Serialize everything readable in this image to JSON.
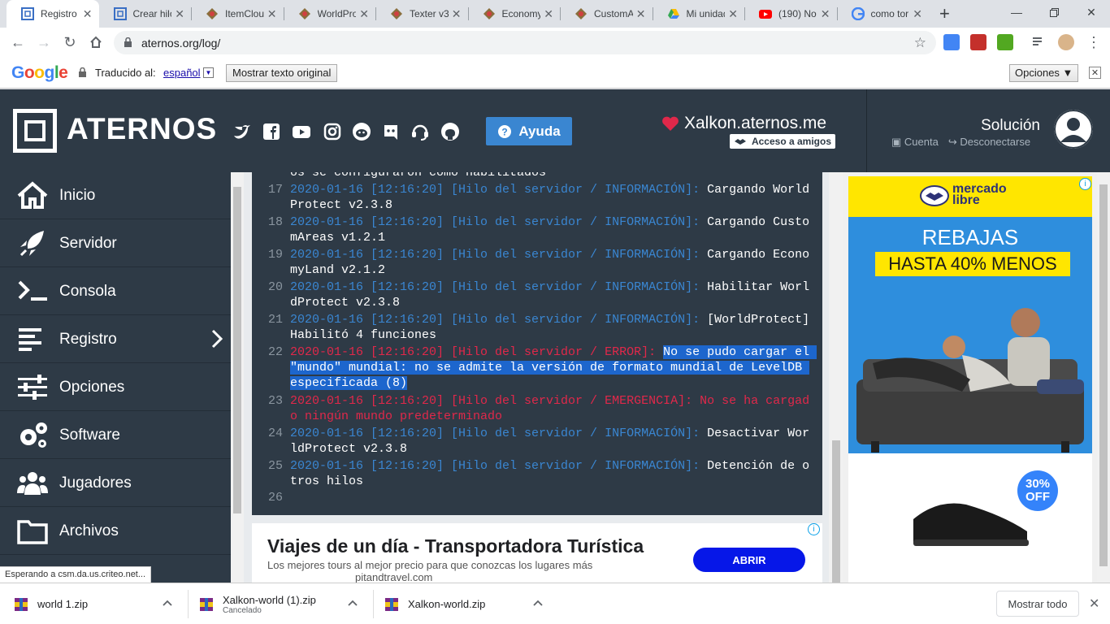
{
  "browser": {
    "tabs": [
      {
        "title": "Registro | A",
        "icon": "aternos-icon",
        "active": true
      },
      {
        "title": "Crear hilo",
        "icon": "aternos-icon"
      },
      {
        "title": "ItemCloud",
        "icon": "poggit-icon"
      },
      {
        "title": "WorldPro",
        "icon": "poggit-icon"
      },
      {
        "title": "Texter v3",
        "icon": "poggit-icon"
      },
      {
        "title": "Economy",
        "icon": "poggit-icon"
      },
      {
        "title": "CustomA",
        "icon": "poggit-icon"
      },
      {
        "title": "Mi unidad",
        "icon": "drive-icon"
      },
      {
        "title": "(190) No",
        "icon": "youtube-icon"
      },
      {
        "title": "como tor",
        "icon": "google-icon"
      }
    ],
    "url": "aternos.org/log/",
    "translate": {
      "logo": "Google",
      "label": "Traducido al:",
      "language": "español",
      "show_original": "Mostrar texto original",
      "options": "Opciones ▼"
    },
    "status_text": "Esperando a csm.da.us.criteo.net...",
    "downloads": [
      {
        "name": "world 1.zip",
        "sub": ""
      },
      {
        "name": "Xalkon-world (1).zip",
        "sub": "Cancelado"
      },
      {
        "name": "Xalkon-world.zip",
        "sub": ""
      }
    ],
    "show_all": "Mostrar todo"
  },
  "header": {
    "logo": "ATERNOS",
    "help": "Ayuda",
    "server_address": "Xalkon.aternos.me",
    "friends_access": "Acceso a amigos",
    "user_name": "Solución",
    "account": "Cuenta",
    "logout": "Desconectarse",
    "social_icons": [
      "twitter-icon",
      "facebook-icon",
      "youtube-icon",
      "instagram-icon",
      "reddit-icon",
      "discord-icon",
      "support-icon",
      "github-icon"
    ]
  },
  "sidebar": {
    "items": [
      {
        "label": "Inicio",
        "icon": "home-icon"
      },
      {
        "label": "Servidor",
        "icon": "rocket-icon"
      },
      {
        "label": "Consola",
        "icon": "terminal-icon"
      },
      {
        "label": "Registro",
        "icon": "log-icon"
      },
      {
        "label": "Opciones",
        "icon": "sliders-icon"
      },
      {
        "label": "Software",
        "icon": "gears-icon"
      },
      {
        "label": "Jugadores",
        "icon": "users-icon"
      },
      {
        "label": "Archivos",
        "icon": "folder-icon"
      }
    ]
  },
  "console": {
    "partial_top": "os se configuraron como habilitados",
    "lines": [
      {
        "n": "17",
        "prefix": "2020-01-16 [12:16:20] [Hilo del servidor / INFORMACIÓN]: ",
        "msg": "Cargando WorldProtect v2.3.8",
        "level": "info"
      },
      {
        "n": "18",
        "prefix": "2020-01-16 [12:16:20] [Hilo del servidor / INFORMACIÓN]: ",
        "msg": "Cargando CustomAreas v1.2.1",
        "level": "info"
      },
      {
        "n": "19",
        "prefix": "2020-01-16 [12:16:20] [Hilo del servidor / INFORMACIÓN]: ",
        "msg": "Cargando EconomyLand v2.1.2",
        "level": "info"
      },
      {
        "n": "20",
        "prefix": "2020-01-16 [12:16:20] [Hilo del servidor / INFORMACIÓN]: ",
        "msg": "Habilitar WorldProtect v2.3.8",
        "level": "info"
      },
      {
        "n": "21",
        "prefix": "2020-01-16 [12:16:20] [Hilo del servidor / INFORMACIÓN]: ",
        "msg": "[WorldProtect] Habilitó 4 funciones",
        "level": "info"
      },
      {
        "n": "22",
        "prefix": "2020-01-16 [12:16:20] [Hilo del servidor / ERROR]: ",
        "msg": "No se pudo cargar el \"mundo\" mundial: no se admite la versión de formato mundial de LevelDB especificada (8)",
        "level": "error"
      },
      {
        "n": "23",
        "prefix": "2020-01-16 [12:16:20] [Hilo del servidor / EMERGENCIA]: ",
        "msg": "No se ha cargado ningún mundo predeterminado",
        "level": "emergency"
      },
      {
        "n": "24",
        "prefix": "2020-01-16 [12:16:20] [Hilo del servidor / INFORMACIÓN]: ",
        "msg": "Desactivar WorldProtect v2.3.8",
        "level": "info"
      },
      {
        "n": "25",
        "prefix": "2020-01-16 [12:16:20] [Hilo del servidor / INFORMACIÓN]: ",
        "msg": "Detención de otros hilos",
        "level": "info"
      },
      {
        "n": "26",
        "prefix": "",
        "msg": "",
        "level": "info"
      }
    ]
  },
  "bottom_ad": {
    "title": "Viajes de un día - Transportadora Turística",
    "desc": "Los mejores tours al mejor precio para que conozcas los lugares más",
    "domain": "pitandtravel.com",
    "cta": "ABRIR"
  },
  "side_ad": {
    "brand_line1": "mercado",
    "brand_line2": "libre",
    "headline": "REBAJAS",
    "subheadline": "HASTA 40% MENOS",
    "badge_pct": "30%",
    "badge_off": "OFF"
  },
  "colors": {
    "panel": "#2e3a46",
    "info": "#3a86d1",
    "error": "#e0284a",
    "selection": "#1d66cd",
    "help_button": "#3a86d1"
  }
}
